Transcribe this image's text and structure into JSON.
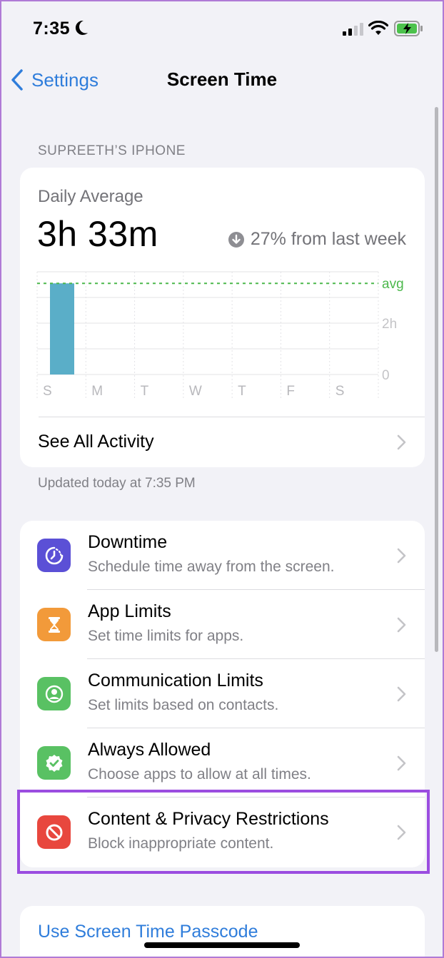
{
  "status_bar": {
    "time": "7:35"
  },
  "nav": {
    "back_label": "Settings",
    "title": "Screen Time"
  },
  "device_header": "SUPREETH’S IPHONE",
  "usage": {
    "daily_label": "Daily Average",
    "daily_value": "3h 33m",
    "trend_text": "27% from last week",
    "see_all_label": "See All Activity"
  },
  "chart_data": {
    "type": "bar",
    "categories": [
      "S",
      "M",
      "T",
      "W",
      "T",
      "F",
      "S"
    ],
    "values": [
      3.55,
      0,
      0,
      0,
      0,
      0,
      0
    ],
    "average": 3.55,
    "ylim": [
      0,
      4
    ],
    "y_ticks": [
      {
        "value": 0,
        "label": "0"
      },
      {
        "value": 2,
        "label": "2h"
      }
    ],
    "avg_label": "avg",
    "bar_color": "#5aaec8",
    "avg_color": "#4cb84c",
    "grid": true
  },
  "updated_text": "Updated today at 7:35 PM",
  "settings_rows": [
    {
      "title": "Downtime",
      "subtitle": "Schedule time away from the screen.",
      "icon": "downtime-icon",
      "color": "#5b50d6"
    },
    {
      "title": "App Limits",
      "subtitle": "Set time limits for apps.",
      "icon": "hourglass-icon",
      "color": "#f29a3a"
    },
    {
      "title": "Communication Limits",
      "subtitle": "Set limits based on contacts.",
      "icon": "person-circle-icon",
      "color": "#59c163"
    },
    {
      "title": "Always Allowed",
      "subtitle": "Choose apps to allow at all times.",
      "icon": "checkmark-seal-icon",
      "color": "#59c163"
    },
    {
      "title": "Content & Privacy Restrictions",
      "subtitle": "Block inappropriate content.",
      "icon": "no-entry-icon",
      "color": "#e8473e"
    }
  ],
  "passcode_label": "Use Screen Time Passcode"
}
